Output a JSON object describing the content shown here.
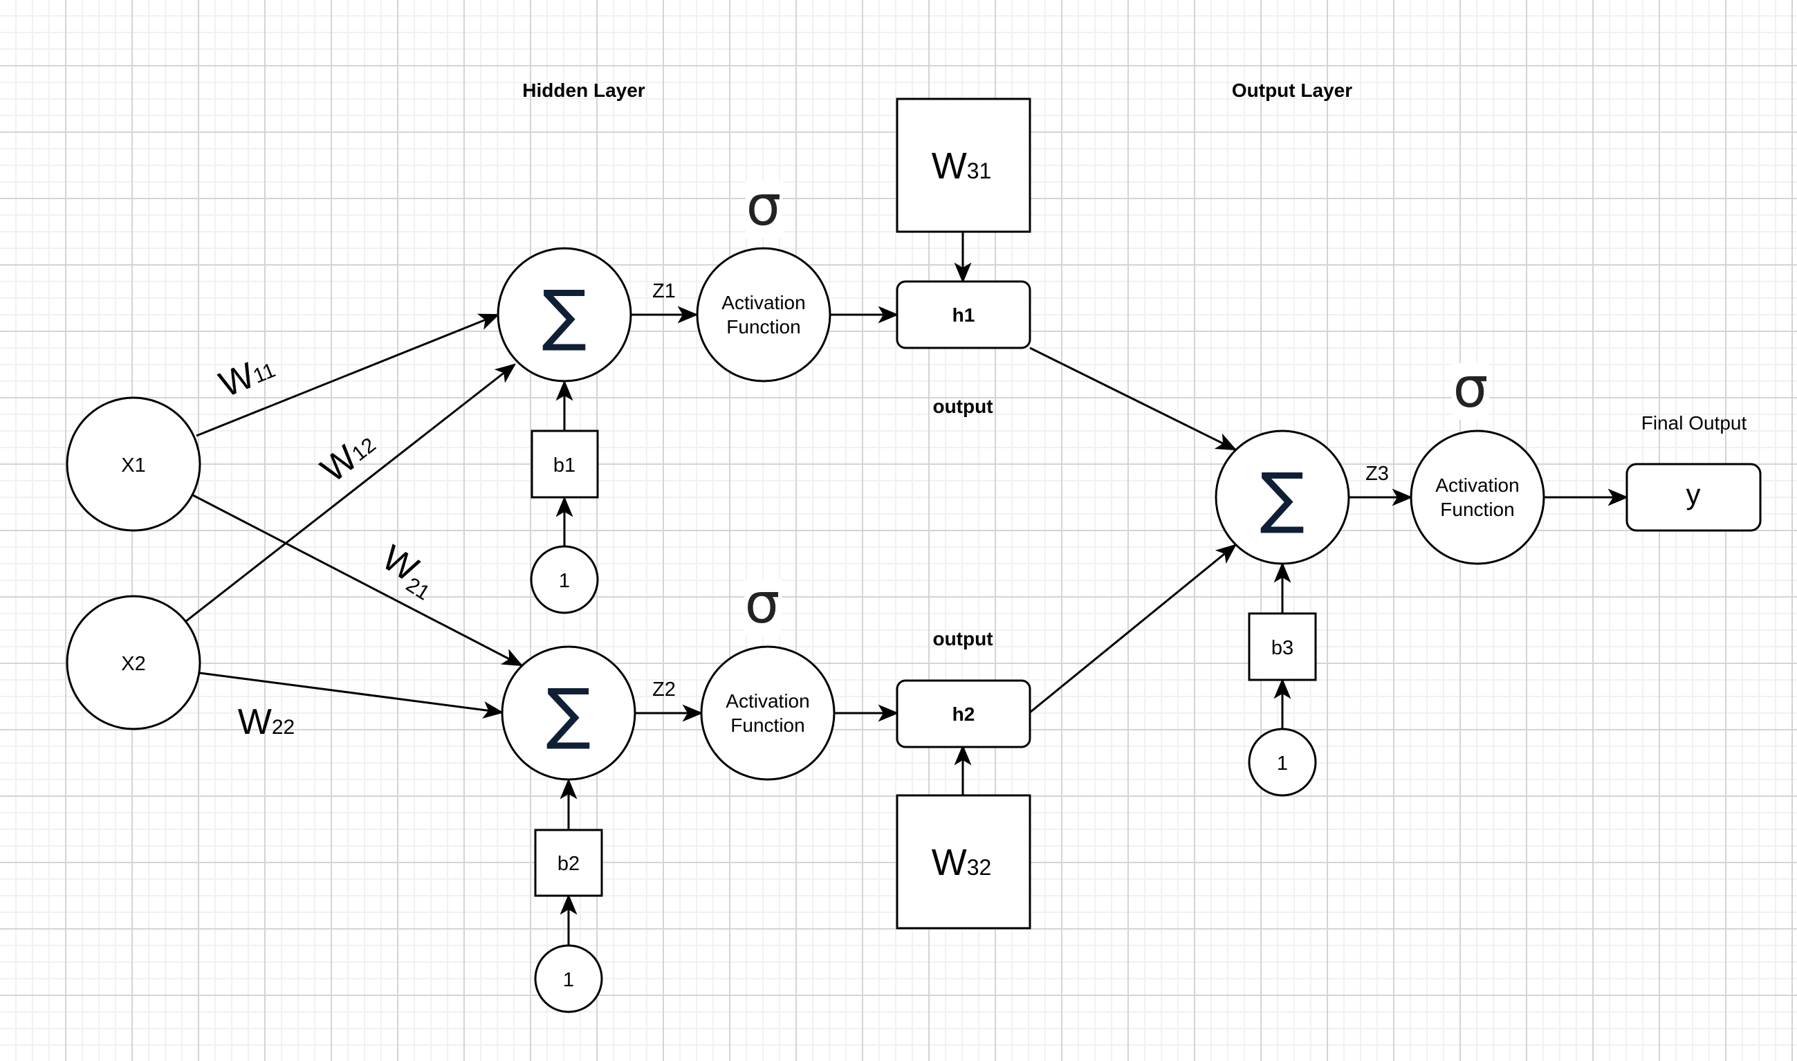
{
  "diagram": {
    "titles": {
      "hidden_layer": "Hidden Layer",
      "output_layer": "Output Layer",
      "final_output": "Final Output",
      "output_top": "output",
      "output_bottom": "output"
    },
    "inputs": [
      {
        "id": "x1",
        "label": "X1"
      },
      {
        "id": "x2",
        "label": "X2"
      }
    ],
    "summation_symbol": "∑",
    "activation_symbol": "σ",
    "summations": [
      {
        "id": "sum1",
        "z_label": "Z1"
      },
      {
        "id": "sum2",
        "z_label": "Z2"
      },
      {
        "id": "sum3",
        "z_label": "Z3"
      }
    ],
    "activations": [
      {
        "id": "af1",
        "line1": "Activation",
        "line2": "Function"
      },
      {
        "id": "af2",
        "line1": "Activation",
        "line2": "Function"
      },
      {
        "id": "af3",
        "line1": "Activation",
        "line2": "Function"
      }
    ],
    "biases": [
      {
        "id": "b1",
        "label": "b1",
        "input": "1"
      },
      {
        "id": "b2",
        "label": "b2",
        "input": "1"
      },
      {
        "id": "b3",
        "label": "b3",
        "input": "1"
      }
    ],
    "hidden_outputs": [
      {
        "id": "h1",
        "label": "h1"
      },
      {
        "id": "h2",
        "label": "h2"
      }
    ],
    "weights": [
      {
        "id": "w11",
        "main": "W",
        "sub": "11"
      },
      {
        "id": "w12",
        "main": "W",
        "sub": "12"
      },
      {
        "id": "w21",
        "main": "W",
        "sub": "21"
      },
      {
        "id": "w22",
        "main": "W",
        "sub": "22"
      }
    ],
    "output_weights": [
      {
        "id": "w31",
        "main": "W",
        "sub": "31"
      },
      {
        "id": "w32",
        "main": "W",
        "sub": "32"
      }
    ],
    "final_node": {
      "id": "y",
      "label": "y"
    },
    "edges": [
      {
        "from": "x1",
        "to": "sum1",
        "weight": "w11"
      },
      {
        "from": "x2",
        "to": "sum1",
        "weight": "w12"
      },
      {
        "from": "x1",
        "to": "sum2",
        "weight": "w21"
      },
      {
        "from": "x2",
        "to": "sum2",
        "weight": "w22"
      },
      {
        "from": "b1",
        "to": "sum1"
      },
      {
        "from": "b2",
        "to": "sum2"
      },
      {
        "from": "one1",
        "to": "b1"
      },
      {
        "from": "one2",
        "to": "b2"
      },
      {
        "from": "sum1",
        "to": "af1",
        "label": "Z1"
      },
      {
        "from": "sum2",
        "to": "af2",
        "label": "Z2"
      },
      {
        "from": "af1",
        "to": "h1"
      },
      {
        "from": "af2",
        "to": "h2"
      },
      {
        "from": "w31",
        "to": "h1"
      },
      {
        "from": "w32",
        "to": "h2"
      },
      {
        "from": "h1",
        "to": "sum3"
      },
      {
        "from": "h2",
        "to": "sum3"
      },
      {
        "from": "b3",
        "to": "sum3"
      },
      {
        "from": "one3",
        "to": "b3"
      },
      {
        "from": "sum3",
        "to": "af3",
        "label": "Z3"
      },
      {
        "from": "af3",
        "to": "y"
      }
    ]
  }
}
